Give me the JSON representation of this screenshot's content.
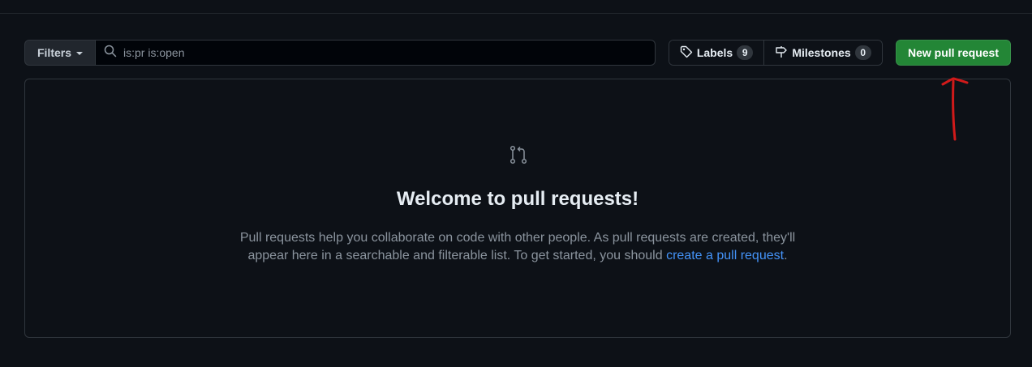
{
  "toolbar": {
    "filters_label": "Filters",
    "search_value": "is:pr is:open",
    "labels_label": "Labels",
    "labels_count": "9",
    "milestones_label": "Milestones",
    "milestones_count": "0",
    "new_pr_label": "New pull request"
  },
  "blankslate": {
    "title": "Welcome to pull requests!",
    "description": "Pull requests help you collaborate on code with other people. As pull requests are created, they'll appear here in a searchable and filterable list. To get started, you should ",
    "link_text": "create a pull request",
    "trailing": "."
  },
  "icons": {
    "filter_caret": "caret-down-icon",
    "search": "search-icon",
    "labels": "tag-icon",
    "milestones": "milestone-icon",
    "empty_state": "git-pull-request-icon"
  },
  "colors": {
    "background": "#0d1117",
    "primary_button": "#238636",
    "link": "#4493f8",
    "annotation": "#d11a1a"
  }
}
